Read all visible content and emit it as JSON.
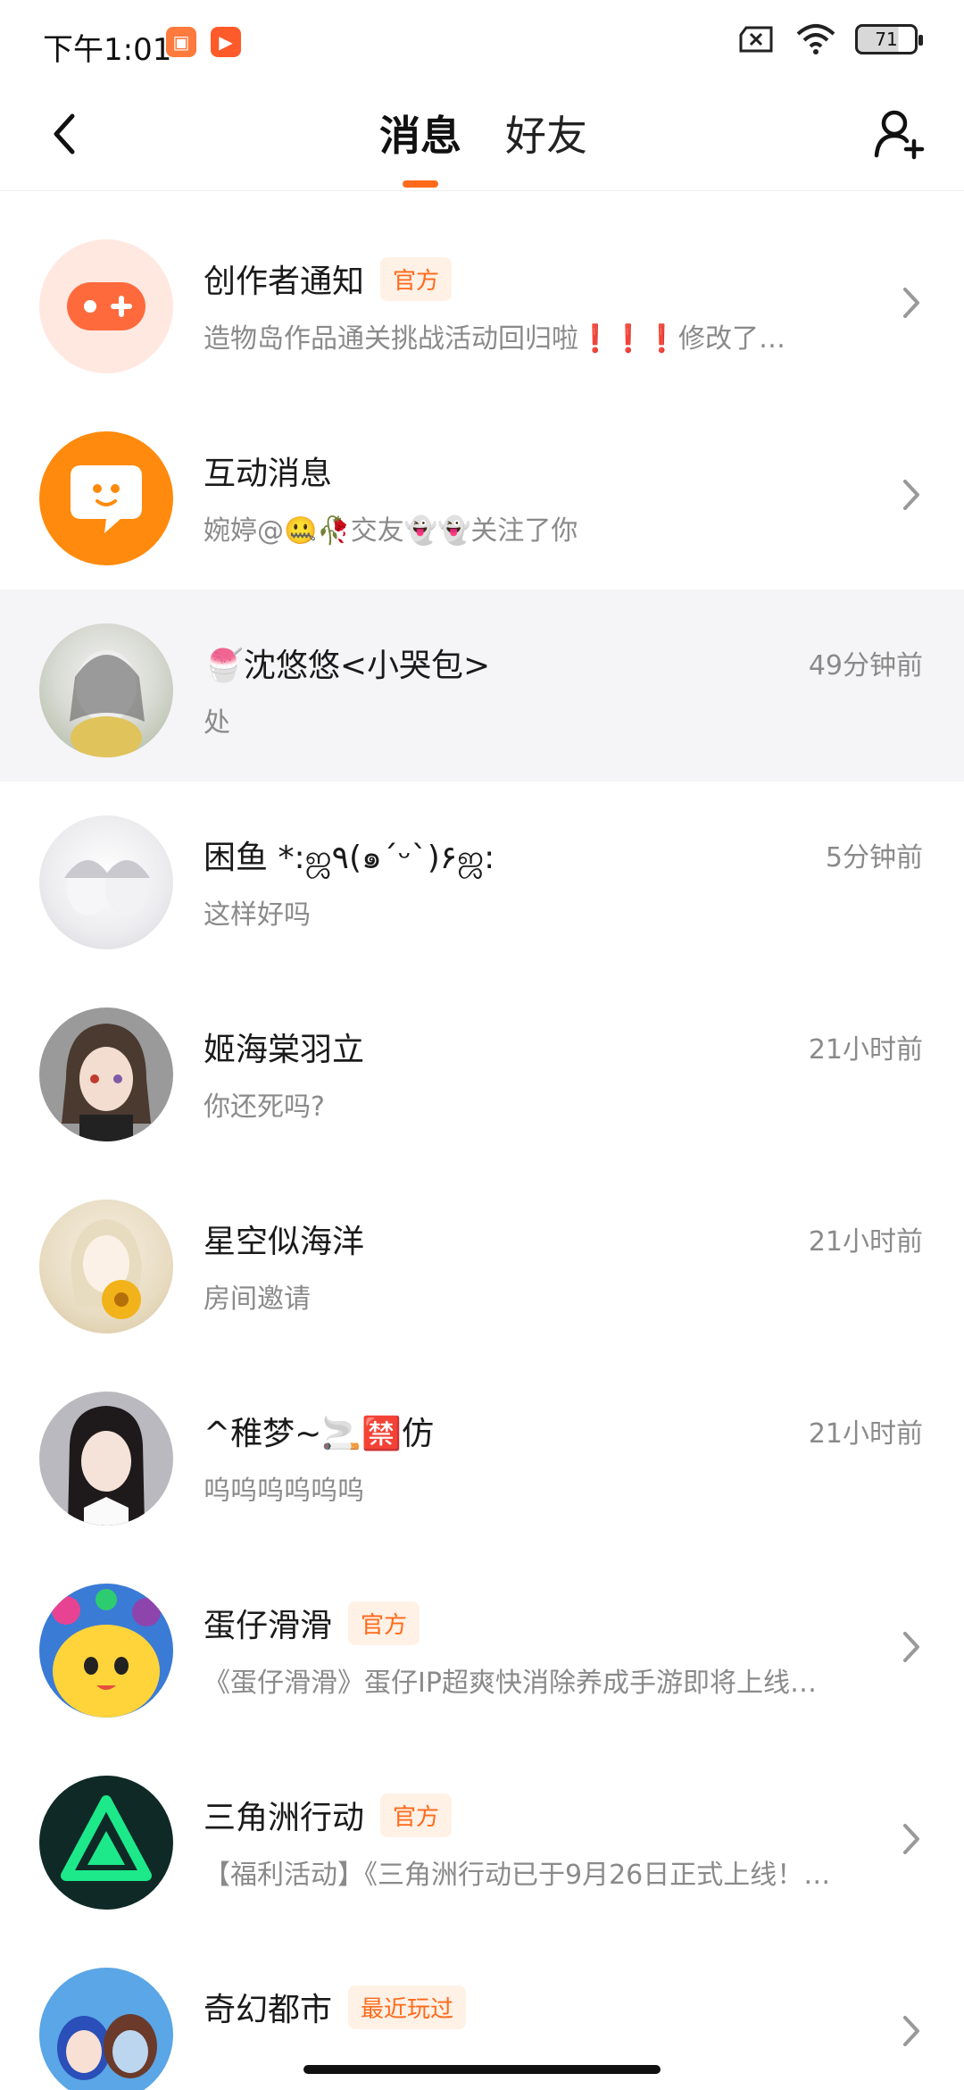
{
  "status_bar": {
    "time": "下午1:01",
    "battery": "71"
  },
  "header": {
    "tabs": [
      {
        "label": "消息",
        "active": true
      },
      {
        "label": "好友",
        "active": false
      }
    ]
  },
  "colors": {
    "accent": "#ff6a1a",
    "tag_bg": "#fff1e6",
    "highlight_row": "#f5f5f7"
  },
  "messages": [
    {
      "name": "创作者通知",
      "tag": "官方",
      "preview": "造物岛作品通关挑战活动回归啦❗❗❗修改了…",
      "time": "",
      "chevron": true,
      "avatar_icon": "gamepad-icon"
    },
    {
      "name": "互动消息",
      "tag": "",
      "preview": "婉婷@🤐🥀交友👻👻关注了你",
      "time": "",
      "chevron": true,
      "avatar_icon": "chat-bubble-icon"
    },
    {
      "name": "🍧沈悠悠<小哭包>",
      "tag": "",
      "preview": "处",
      "time": "49分钟前",
      "chevron": false,
      "avatar_icon": "user-avatar"
    },
    {
      "name": "困鱼 *:ஜ٩(๑´ᵕ`)۶ஜ:",
      "tag": "",
      "preview": "这样好吗",
      "time": "5分钟前",
      "chevron": false,
      "avatar_icon": "user-avatar"
    },
    {
      "name": "姬海棠羽立",
      "tag": "",
      "preview": "你还死吗?",
      "time": "21小时前",
      "chevron": false,
      "avatar_icon": "user-avatar"
    },
    {
      "name": "星空似海洋",
      "tag": "",
      "preview": "房间邀请",
      "time": "21小时前",
      "chevron": false,
      "avatar_icon": "user-avatar"
    },
    {
      "name": "^稚梦~🚬🈲仿",
      "tag": "",
      "preview": "呜呜呜呜呜呜",
      "time": "21小时前",
      "chevron": false,
      "avatar_icon": "user-avatar"
    },
    {
      "name": "蛋仔滑滑",
      "tag": "官方",
      "preview": "《蛋仔滑滑》蛋仔IP超爽快消除养成手游即将上线…",
      "time": "",
      "chevron": true,
      "avatar_icon": "game-avatar"
    },
    {
      "name": "三角洲行动",
      "tag": "官方",
      "preview": "【福利活动】《三角洲行动已于9月26日正式上线！…",
      "time": "",
      "chevron": true,
      "avatar_icon": "game-avatar"
    },
    {
      "name": "奇幻都市",
      "tag": "最近玩过",
      "preview": "",
      "time": "",
      "chevron": true,
      "avatar_icon": "game-avatar"
    }
  ]
}
